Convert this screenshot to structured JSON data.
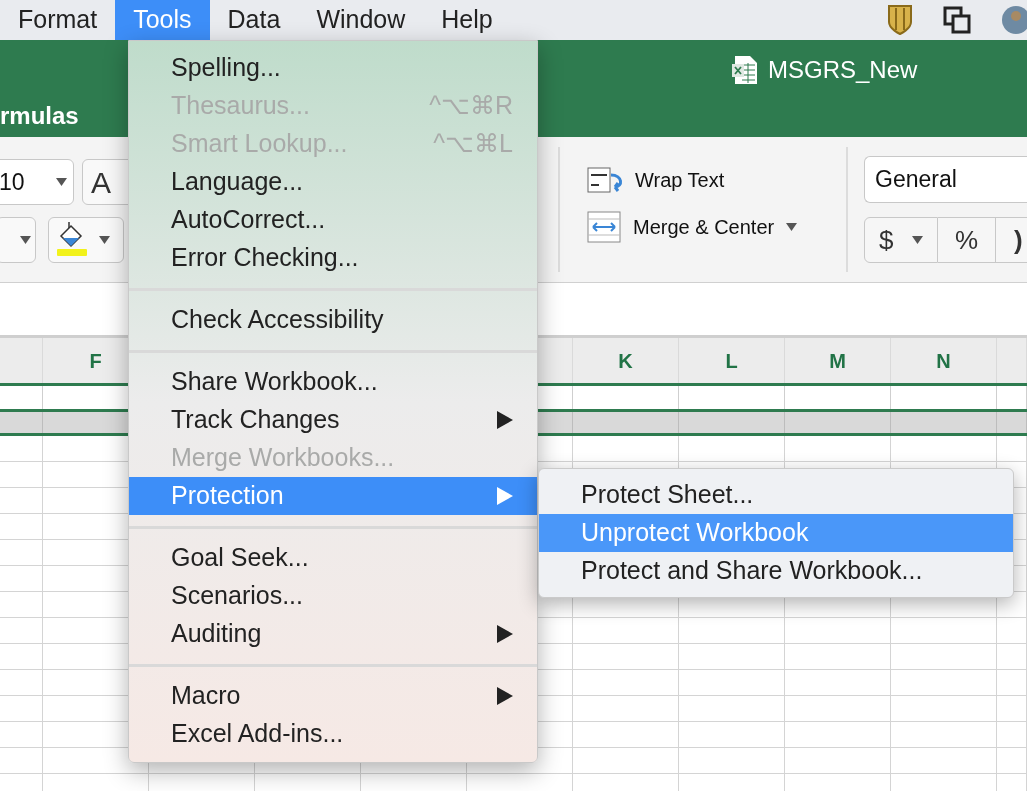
{
  "menubar": {
    "items": [
      {
        "label": "Format",
        "selected": false
      },
      {
        "label": "Tools",
        "selected": true
      },
      {
        "label": "Data",
        "selected": false
      },
      {
        "label": "Window",
        "selected": false
      },
      {
        "label": "Help",
        "selected": false
      }
    ]
  },
  "window": {
    "title": "MSGRS_New"
  },
  "ribbon": {
    "tab": "rmulas",
    "font_size": "10",
    "grow_font": "A",
    "wrap_text": "Wrap Text",
    "merge_center": "Merge & Center",
    "number_format": "General",
    "currency": "$",
    "percent": "%",
    "comma_style": ")"
  },
  "sheet": {
    "columns": [
      "F",
      "K",
      "L",
      "M",
      "N"
    ]
  },
  "menu": {
    "groups": [
      {
        "items": [
          {
            "label": "Spelling...",
            "disabled": false,
            "selected": false,
            "submenu": false
          },
          {
            "label": "Thesaurus...",
            "shortcut": "^⌥⌘R",
            "disabled": true,
            "selected": false,
            "submenu": false
          },
          {
            "label": "Smart Lookup...",
            "shortcut": "^⌥⌘L",
            "disabled": true,
            "selected": false,
            "submenu": false
          },
          {
            "label": "Language...",
            "disabled": false,
            "selected": false,
            "submenu": false
          },
          {
            "label": "AutoCorrect...",
            "disabled": false,
            "selected": false,
            "submenu": false
          },
          {
            "label": "Error Checking...",
            "disabled": false,
            "selected": false,
            "submenu": false
          }
        ]
      },
      {
        "items": [
          {
            "label": "Check Accessibility",
            "disabled": false,
            "selected": false,
            "submenu": false
          }
        ]
      },
      {
        "items": [
          {
            "label": "Share Workbook...",
            "disabled": false,
            "selected": false,
            "submenu": false
          },
          {
            "label": "Track Changes",
            "disabled": false,
            "selected": false,
            "submenu": true
          },
          {
            "label": "Merge Workbooks...",
            "disabled": true,
            "selected": false,
            "submenu": false
          },
          {
            "label": "Protection",
            "disabled": false,
            "selected": true,
            "submenu": true
          }
        ]
      },
      {
        "items": [
          {
            "label": "Goal Seek...",
            "disabled": false,
            "selected": false,
            "submenu": false
          },
          {
            "label": "Scenarios...",
            "disabled": false,
            "selected": false,
            "submenu": false
          },
          {
            "label": "Auditing",
            "disabled": false,
            "selected": false,
            "submenu": true
          }
        ]
      },
      {
        "items": [
          {
            "label": "Macro",
            "disabled": false,
            "selected": false,
            "submenu": true
          },
          {
            "label": "Excel Add-ins...",
            "disabled": false,
            "selected": false,
            "submenu": false
          }
        ]
      }
    ]
  },
  "submenu": {
    "items": [
      {
        "label": "Protect Sheet...",
        "selected": false
      },
      {
        "label": "Unprotect Workbook",
        "selected": true
      },
      {
        "label": "Protect and Share Workbook...",
        "selected": false
      }
    ]
  }
}
